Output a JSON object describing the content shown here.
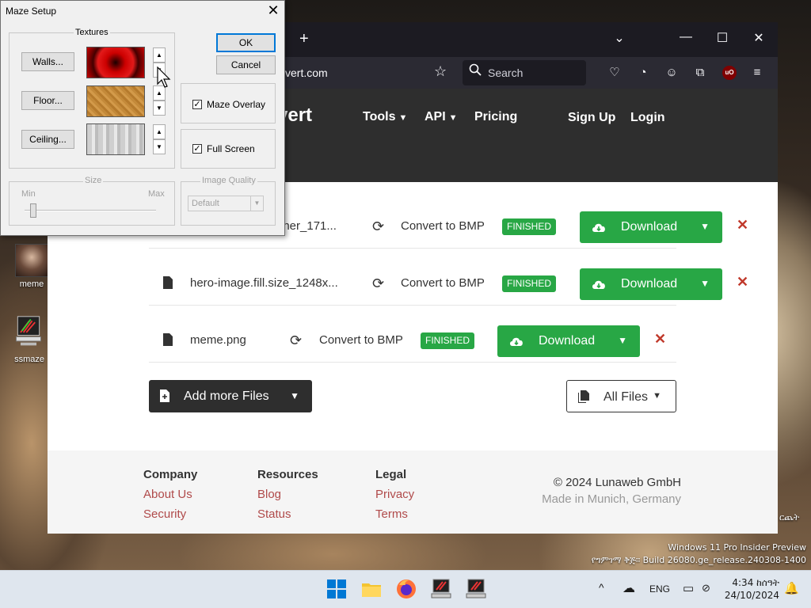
{
  "dialog": {
    "title": "Maze Setup",
    "textures_label": "Textures",
    "walls_btn": "Walls...",
    "floor_btn": "Floor...",
    "ceiling_btn": "Ceiling...",
    "ok_btn": "OK",
    "cancel_btn": "Cancel",
    "maze_overlay": "Maze Overlay",
    "full_screen": "Full Screen",
    "size_label": "Size",
    "size_min": "Min",
    "size_max": "Max",
    "image_quality_label": "Image Quality",
    "image_quality_value": "Default"
  },
  "browser": {
    "url": "vert.com",
    "search_placeholder": "Search",
    "logo_tail": "vert",
    "nav": {
      "tools": "Tools",
      "api": "API",
      "pricing": "Pricing",
      "signup": "Sign Up",
      "login": "Login"
    }
  },
  "files": [
    {
      "name": "iner_171...",
      "action": "Convert to BMP",
      "status": "FINISHED",
      "download": "Download"
    },
    {
      "name": "hero-image.fill.size_1248x...",
      "action": "Convert to BMP",
      "status": "FINISHED",
      "download": "Download"
    },
    {
      "name": "meme.png",
      "action": "Convert to BMP",
      "status": "FINISHED",
      "download": "Download"
    }
  ],
  "actions": {
    "add_more": "Add more Files",
    "all_files": "All Files"
  },
  "footer": {
    "company": {
      "title": "Company",
      "links": [
        "About Us",
        "Security"
      ]
    },
    "resources": {
      "title": "Resources",
      "links": [
        "Blog",
        "Status"
      ]
    },
    "legal": {
      "title": "Legal",
      "links": [
        "Privacy",
        "Terms"
      ]
    },
    "copyright": "© 2024 Lunaweb GmbH",
    "made_in": "Made in Munich, Germany"
  },
  "desktop": {
    "icons": [
      "meme",
      "ssmaze"
    ],
    "right_label": "ርጨት",
    "watermark_line1": "Windows 11 Pro Insider Preview",
    "watermark_line2": "የግምገማ ቅጅ። Build 26080.ge_release.240308-1400"
  },
  "taskbar": {
    "lang": "ENG",
    "time": "4:34 ከሰዓት",
    "date": "24/10/2024"
  },
  "colors": {
    "accent_green": "#28a745",
    "dark": "#2e2e2e",
    "link_red": "#b04a4a",
    "close_red": "#c0392b"
  }
}
